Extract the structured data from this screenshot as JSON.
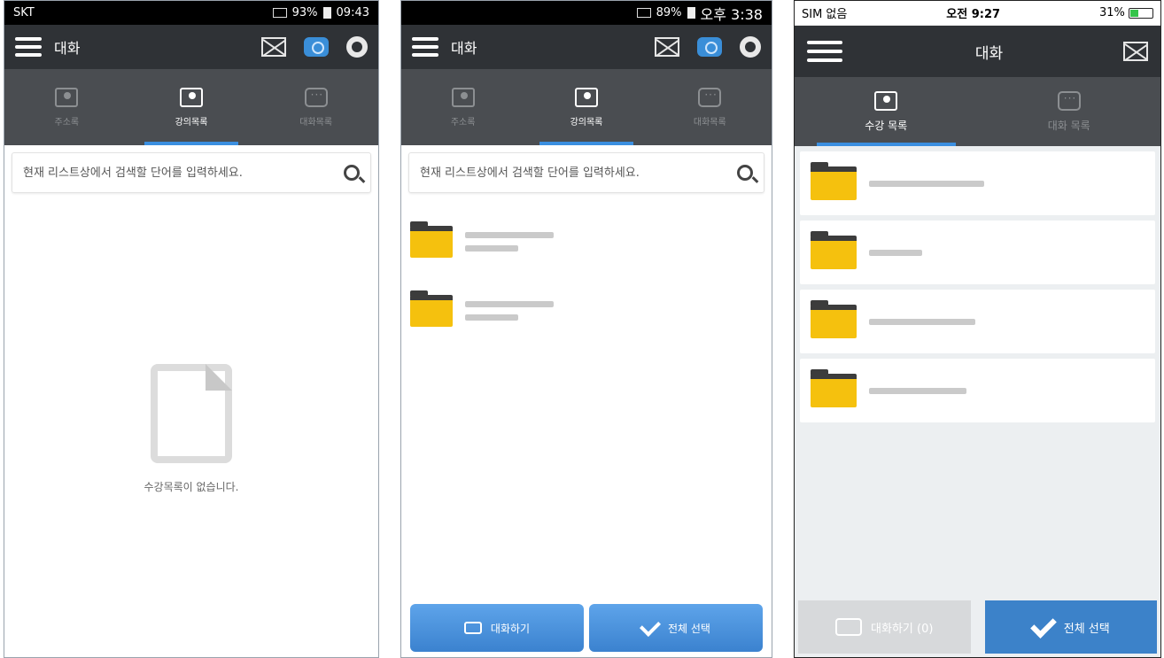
{
  "panel1": {
    "status": {
      "carrier": "SKT",
      "time": "09:43",
      "battery": "93%"
    },
    "app_title": "대화",
    "tabs": [
      {
        "label": "주소록"
      },
      {
        "label": "강의목록",
        "active": true
      },
      {
        "label": "대화목록"
      }
    ],
    "search_placeholder": "현재 리스트상에서 검색할 단어를 입력하세요.",
    "empty_text": "수강목록이 없습니다."
  },
  "panel2": {
    "status": {
      "time": "오후 3:38",
      "battery": "89%"
    },
    "app_title": "대화",
    "tabs": [
      {
        "label": "주소록"
      },
      {
        "label": "강의목록",
        "active": true
      },
      {
        "label": "대화목록"
      }
    ],
    "search_placeholder": "현재 리스트상에서 검색할 단어를 입력하세요.",
    "buttons": {
      "chat": "대화하기",
      "select_all": "전체 선택"
    }
  },
  "panel3": {
    "status": {
      "carrier": "SIM 없음",
      "time": "오전 9:27",
      "battery": "31%"
    },
    "app_title": "대화",
    "tabs": [
      {
        "label": "수강 목록",
        "active": true
      },
      {
        "label": "대화 목록"
      }
    ],
    "buttons": {
      "chat": "대화하기 (0)",
      "select_all": "전체 선택"
    }
  },
  "colors": {
    "appbar": "#2f3236",
    "tabbar": "#4a4d51",
    "accent": "#3b8fe0",
    "folder": "#f5c10e"
  }
}
